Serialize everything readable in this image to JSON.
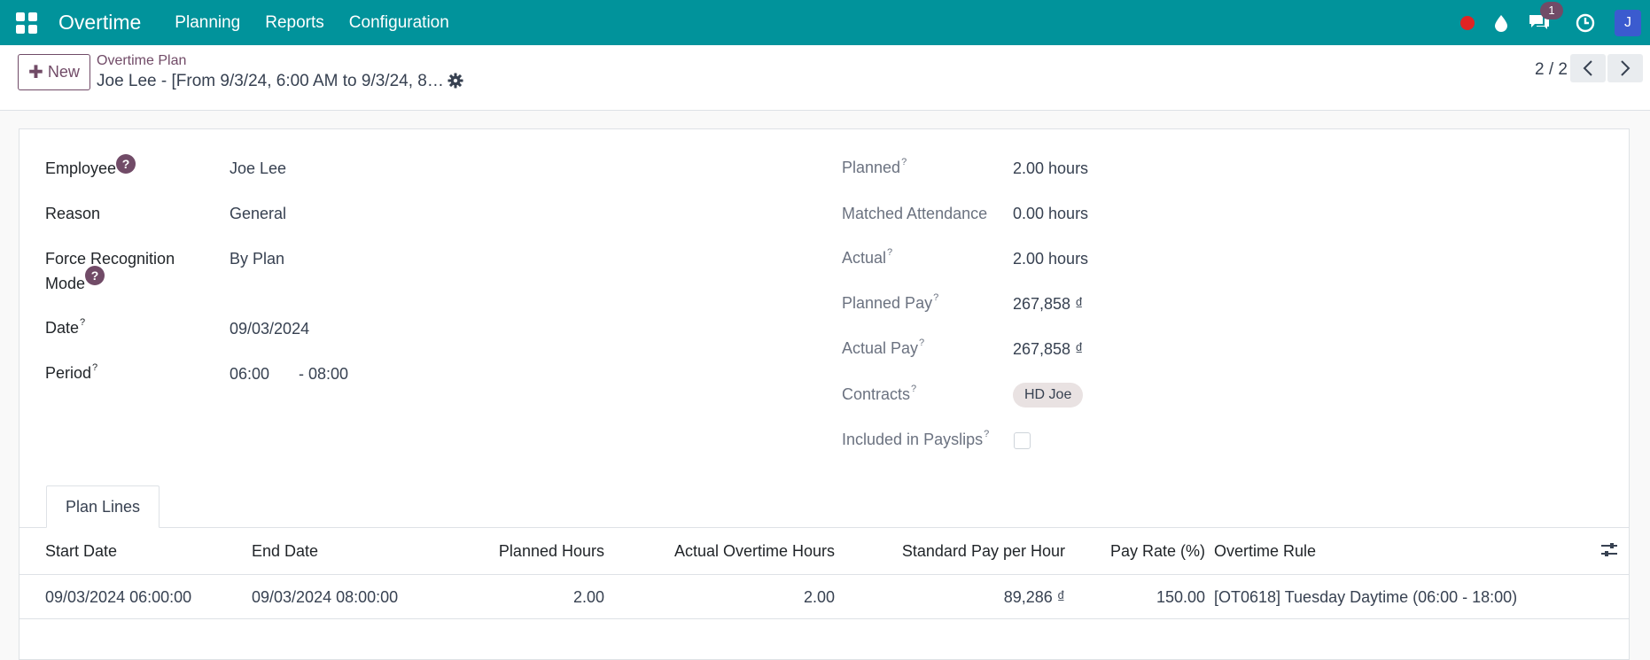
{
  "navbar": {
    "brand": "Overtime",
    "menu": [
      "Planning",
      "Reports",
      "Configuration"
    ],
    "chat_badge": "1",
    "avatar": "J",
    "icons": [
      "apps-icon",
      "record-dot-icon",
      "droplet-icon",
      "chat-icon",
      "clock-icon"
    ]
  },
  "control": {
    "new_label": "New",
    "breadcrumb": "Overtime Plan",
    "title": "Joe Lee - [From 9/3/24, 6:00 AM to 9/3/24, 8…",
    "pager": "2 / 2"
  },
  "form": {
    "left": {
      "employee_label": "Employee",
      "employee": "Joe Lee",
      "reason_label": "Reason",
      "reason": "General",
      "force_label_1": "Force Recognition",
      "force_label_2": "Mode",
      "force": "By Plan",
      "date_label": "Date",
      "date": "09/03/2024",
      "period_label": "Period",
      "period_from": "06:00",
      "period_to": "- 08:00",
      "help": "?"
    },
    "right": {
      "planned_label": "Planned",
      "planned": "2.00 hours",
      "matched_label": "Matched Attendance",
      "matched": "0.00 hours",
      "actual_label": "Actual",
      "actual": "2.00 hours",
      "planned_pay_label": "Planned Pay",
      "planned_pay": "267,858 ₫",
      "actual_pay_label": "Actual Pay",
      "actual_pay": "267,858 ₫",
      "contracts_label": "Contracts",
      "contract_tag": "HD Joe",
      "payslips_label": "Included in Payslips",
      "payslips_checked": false
    }
  },
  "tabs": {
    "active": "Plan Lines"
  },
  "table": {
    "headers": [
      "Start Date",
      "End Date",
      "Planned Hours",
      "Actual Overtime Hours",
      "Standard Pay per Hour",
      "Pay Rate (%)",
      "Overtime Rule"
    ],
    "rows": [
      [
        "09/03/2024 06:00:00",
        "09/03/2024 08:00:00",
        "2.00",
        "2.00",
        "89,286 ₫",
        "150.00",
        "[OT0618] Tuesday Daytime (06:00 - 18:00)"
      ]
    ]
  },
  "colors": {
    "navbar": "#01939b",
    "primary": "#714B67",
    "avatar": "#3b5bcf",
    "record": "#e02424"
  }
}
